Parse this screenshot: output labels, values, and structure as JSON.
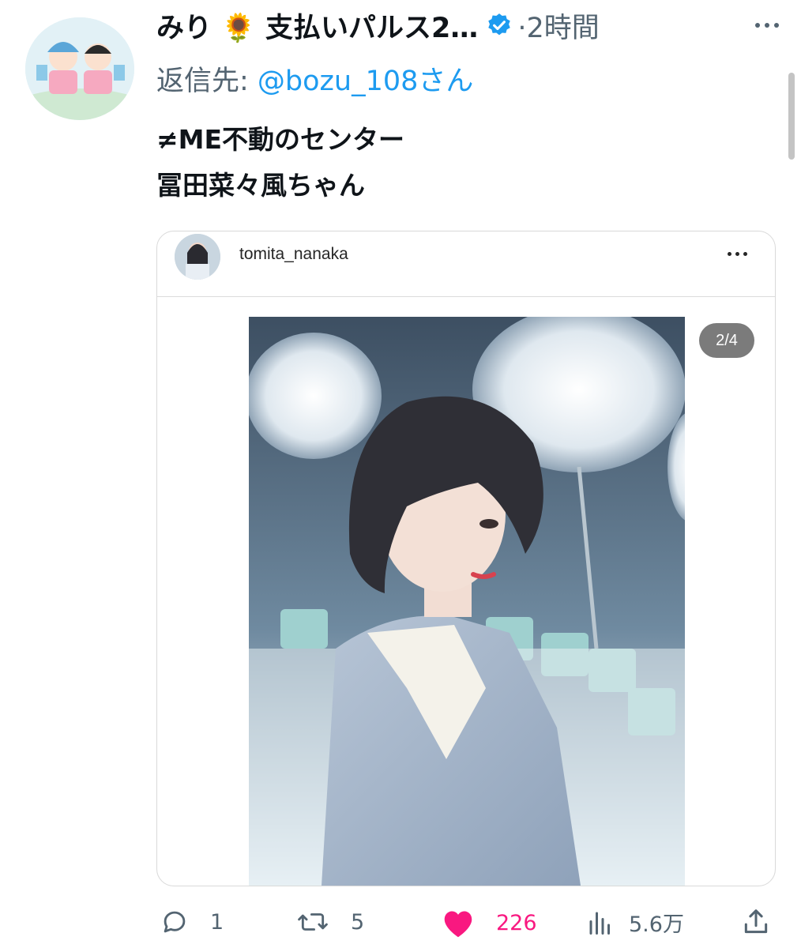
{
  "tweet": {
    "display_name": "みり 🌻 支払いパルス2…",
    "time": "·2時間",
    "reply_label": "返信先: ",
    "reply_handle": "@bozu_108さん",
    "text_lines": [
      "≠ME不動のセンター",
      "冨田菜々風ちゃん"
    ]
  },
  "card": {
    "username": "tomita_nanaka",
    "counter": "2/4"
  },
  "actions": {
    "replies": "1",
    "retweets": "5",
    "likes": "226",
    "views": "5.6万"
  },
  "colors": {
    "verified": "#1d9bf0",
    "like": "#f91880",
    "muted": "#536471"
  },
  "icons": [
    "verified-badge-icon",
    "more-icon",
    "reply-icon",
    "retweet-icon",
    "heart-icon",
    "views-icon",
    "share-icon"
  ]
}
